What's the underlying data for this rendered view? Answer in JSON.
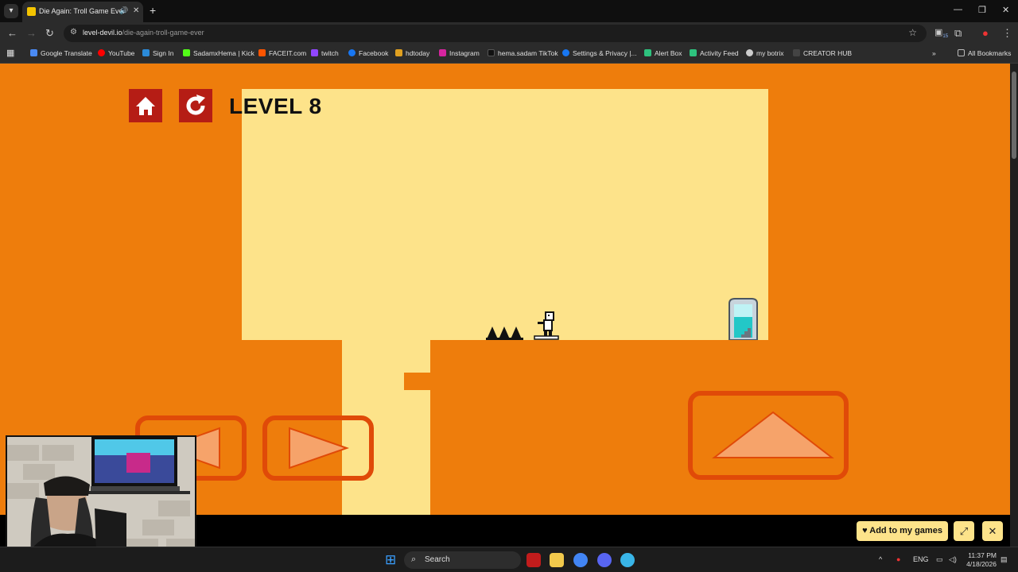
{
  "browser": {
    "tab_title": "Die Again: Troll Game Ever",
    "url_host": "level-devil.io",
    "url_path": "/die-again-troll-game-ever",
    "bookmarks": [
      "Google Translate",
      "YouTube",
      "Sign In",
      "SadamxHema | Kick",
      "FACEIT.com",
      "twitch",
      "Facebook",
      "hdtoday",
      "Instagram",
      "hema.sadam TikTok",
      "Settings & Privacy |...",
      "Alert Box",
      "Activity Feed",
      "my botrix",
      "CREATOR HUB"
    ],
    "all_bookmarks": "All Bookmarks",
    "extension_badge": "15"
  },
  "game": {
    "level_label": "LEVEL 8",
    "add_to_games": "Add to my games"
  },
  "taskbar": {
    "search": "Search",
    "language": "ENG",
    "time": "11:37 PM",
    "date": "4/18/2026"
  },
  "colors": {
    "background": "#ee7d0c",
    "room": "#fde38a",
    "button_red": "#b51d15",
    "control_outline": "#e04a08"
  }
}
